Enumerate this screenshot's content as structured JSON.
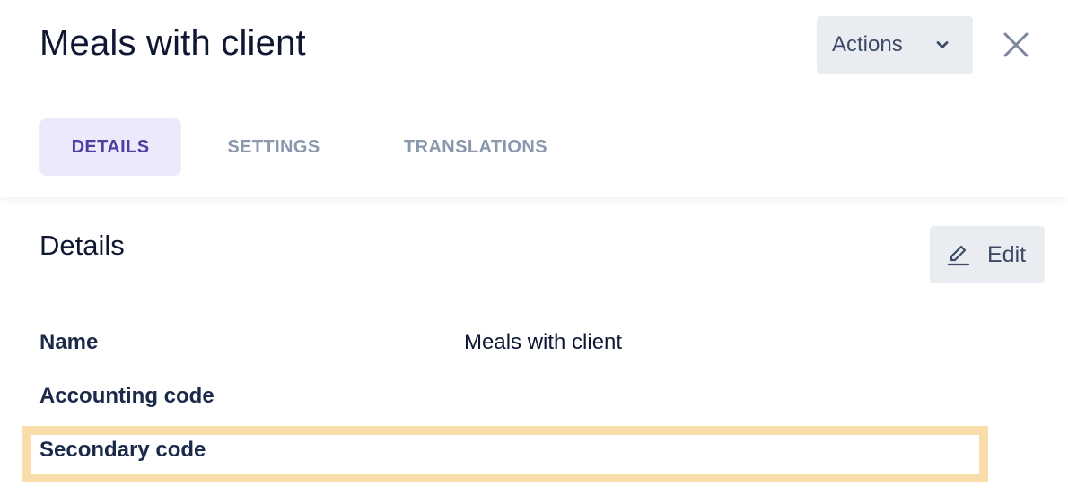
{
  "header": {
    "title": "Meals with client",
    "actions_label": "Actions"
  },
  "tabs": [
    {
      "label": "DETAILS",
      "active": true
    },
    {
      "label": "SETTINGS",
      "active": false
    },
    {
      "label": "TRANSLATIONS",
      "active": false
    }
  ],
  "details": {
    "title": "Details",
    "edit_label": "Edit",
    "fields": [
      {
        "label": "Name",
        "value": "Meals with client"
      },
      {
        "label": "Accounting code",
        "value": ""
      },
      {
        "label": "Secondary code",
        "value": ""
      }
    ]
  },
  "icons": {
    "actions": "chevron-down-icon",
    "close": "close-icon",
    "edit": "pencil-icon"
  },
  "colors": {
    "active_tab_bg": "#ece9fb",
    "active_tab_text": "#4e3fa0",
    "highlight_border": "#f8dcaa",
    "button_bg": "#e9ecf1"
  }
}
